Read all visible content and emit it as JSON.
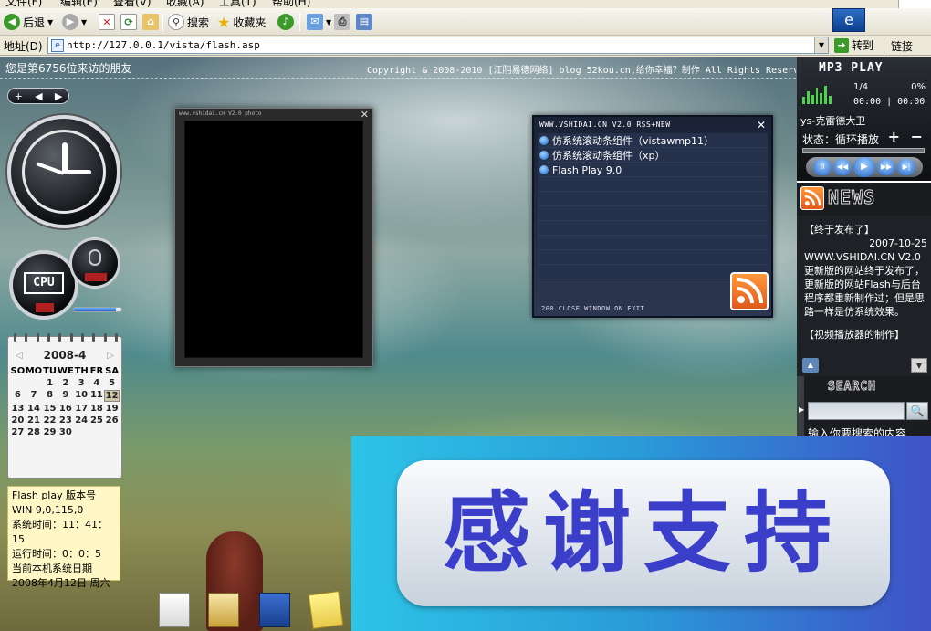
{
  "browser": {
    "menu": [
      "文件(F)",
      "编辑(E)",
      "查看(V)",
      "收藏(A)",
      "工具(T)",
      "帮助(H)"
    ],
    "toolbar": {
      "back_label": "后退",
      "search_label": "搜索",
      "favorites_label": "收藏夹"
    },
    "address": {
      "label": "地址(D)",
      "url": "http://127.0.0.1/vista/flash.asp",
      "go_label": "转到",
      "links_label": "链接"
    }
  },
  "page": {
    "visitor_text": "您是第6756位来访的朋友",
    "copyright_text": "Copyright & 2008-2010 [江阴易德网络] blog 52kou.cn,给你幸福？制作 All Rights Reserved",
    "nav_pill": {
      "add": "+",
      "prev": "◀",
      "next": "▶"
    },
    "cpu_label": "CPU",
    "calendar": {
      "title": "2008-4",
      "weekdays": [
        "SO",
        "MO",
        "TU",
        "WE",
        "TH",
        "FR",
        "SA"
      ],
      "days": [
        "",
        "",
        "1",
        "2",
        "3",
        "4",
        "5",
        "6",
        "7",
        "8",
        "9",
        "10",
        "11",
        "12",
        "13",
        "14",
        "15",
        "16",
        "17",
        "18",
        "19",
        "20",
        "21",
        "22",
        "23",
        "24",
        "25",
        "26",
        "27",
        "28",
        "29",
        "30",
        "",
        "",
        ""
      ],
      "today": "12"
    },
    "flash_info": [
      "Flash play 版本号",
      "WIN 9,0,115,0",
      "系统时间：11：41：15",
      "运行时间：0：0：5",
      "当前本机系统日期",
      "2008年4月12日 周六"
    ],
    "photo_panel": {
      "title": "www.vshidai.cn V2.0 photo",
      "close": "✕"
    },
    "rss_panel": {
      "title": "WWW.VSHIDAI.CN V2.0 RSS+NEW",
      "close": "✕",
      "items": [
        "仿系统滚动条组件（vistawmp11）",
        "仿系统滚动条组件（xp）",
        "Flash Play 9.0"
      ],
      "footer": "200 CLOSE WINDOW ON EXIT"
    },
    "mp3_player": {
      "title": "MP3 PLAY",
      "track": "1/4",
      "percent": "0%",
      "time": "00:00 | 00:00",
      "song": "ys-克雷德大卫",
      "status": "状态：循环播放",
      "volume": "+ −",
      "controls": [
        "II",
        "◀◀",
        "▶",
        "▶▶",
        "▶|"
      ]
    },
    "news": {
      "title": "NEWS",
      "headline1": "【终于发布了】",
      "date1": "2007-10-25",
      "body1": "WWW.VSHIDAI.CN V2.0更新版的网站终于发布了，更新版的网站Flash与后台程序都重新制作过；但是思路一样是仿系统效果。",
      "headline2": "【视频播放器的制作】"
    },
    "search": {
      "title": "SEARCH",
      "hint": "输入你要搜索的内容",
      "button": "🔍"
    },
    "banner_text": "感谢支持"
  }
}
